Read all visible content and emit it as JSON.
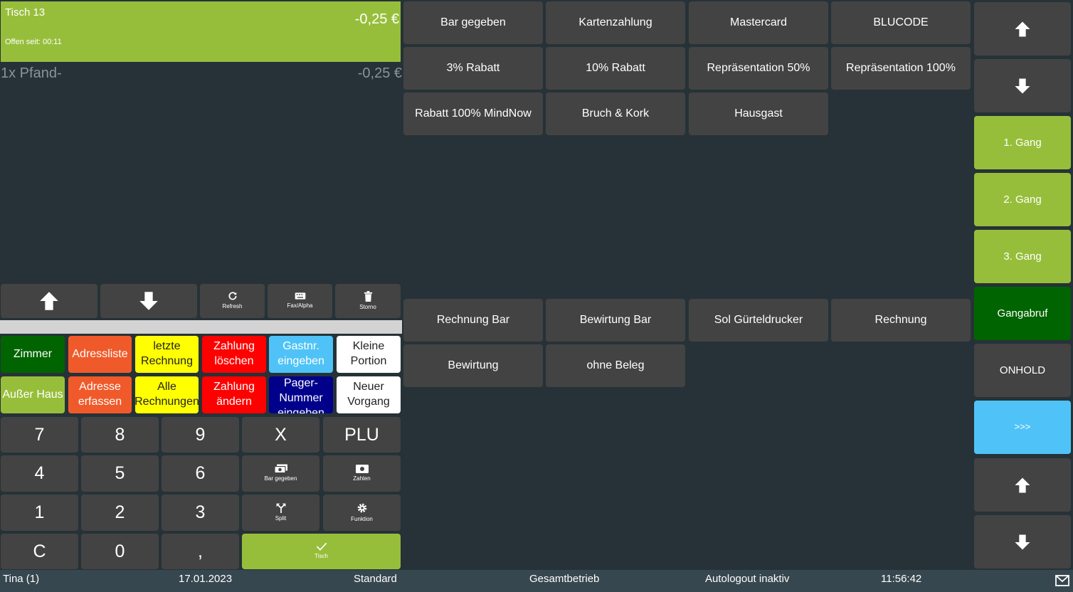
{
  "order": {
    "title": "Tisch 13",
    "total": "-0,25 €",
    "open_since": "Offen seit: 00:11",
    "items": [
      {
        "label": "1x Pfand-",
        "price": "-0,25 €"
      }
    ]
  },
  "list_controls": {
    "refresh": "Refresh",
    "fax_alpha": "Fax/Alpha",
    "storno": "Storno"
  },
  "functions": {
    "zimmer": "Zimmer",
    "adressliste": "Adressliste",
    "letzte_rechnung": "letzte Rechnung",
    "zahlung_loeschen": "Zahlung löschen",
    "gastnr": "Gastnr. eingeben",
    "kleine_portion": "Kleine Portion",
    "ausser_haus": "Außer Haus",
    "adresse_erfassen": "Adresse erfassen",
    "alle_rechnungen": "Alle Rechnungen",
    "zahlung_aendern": "Zahlung ändern",
    "pager": "Pager-Nummer eingeben",
    "neuer_vorgang": "Neuer Vorgang"
  },
  "keypad": {
    "k7": "7",
    "k8": "8",
    "k9": "9",
    "x": "X",
    "plu": "PLU",
    "k4": "4",
    "k5": "5",
    "k6": "6",
    "bar_gegeben": "Bar gegeben",
    "zahlen": "Zahlen",
    "k1": "1",
    "k2": "2",
    "k3": "3",
    "split": "Split",
    "funktion": "Funktion",
    "c": "C",
    "k0": "0",
    "comma": ",",
    "tisch": "Tisch"
  },
  "payment_top": [
    "Bar gegeben",
    "Kartenzahlung",
    "Mastercard",
    "BLUCODE",
    "3% Rabatt",
    "10% Rabatt",
    "Repräsentation 50%",
    "Repräsentation 100%",
    "Rabatt 100% MindNow",
    "Bruch & Kork",
    "Hausgast"
  ],
  "payment_bottom": [
    "Rechnung Bar",
    "Bewirtung Bar",
    "Sol Gürteldrucker",
    "Rechnung",
    "Bewirtung",
    "ohne Beleg"
  ],
  "sidebar": {
    "gang1": "1. Gang",
    "gang2": "2. Gang",
    "gang3": "3. Gang",
    "gangabruf": "Gangabruf",
    "onhold": "ONHOLD",
    "more": ">>>"
  },
  "status": {
    "user": "Tina (1)",
    "date": "17.01.2023",
    "mode": "Standard",
    "scope": "Gesamtbetrieb",
    "autologout": "Autologout inaktiv",
    "time": "11:56:42"
  },
  "colors": {
    "background": "#263238",
    "button": "#434343",
    "accent_green": "#97be3b",
    "accent_blue": "#4fc3f7"
  }
}
